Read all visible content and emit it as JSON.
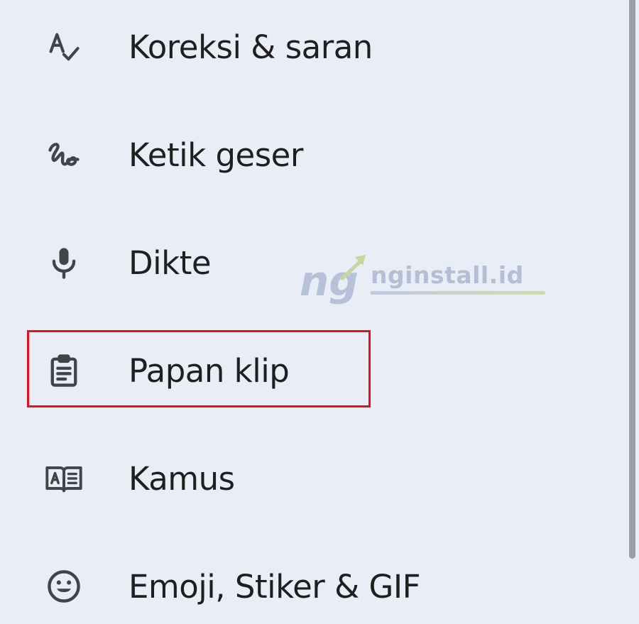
{
  "menu": {
    "items": [
      {
        "label": "Koreksi & saran",
        "icon": "spellcheck-icon"
      },
      {
        "label": "Ketik geser",
        "icon": "gesture-icon"
      },
      {
        "label": "Dikte",
        "icon": "microphone-icon"
      },
      {
        "label": "Papan klip",
        "icon": "clipboard-icon",
        "highlighted": true
      },
      {
        "label": "Kamus",
        "icon": "dictionary-book-icon"
      },
      {
        "label": "Emoji, Stiker & GIF",
        "icon": "emoji-icon"
      }
    ]
  },
  "watermark": {
    "logo_letters": "ng",
    "text": "nginstall.id"
  },
  "colors": {
    "background": "#e9eef6",
    "text": "#1f1f1f",
    "icon": "#414549",
    "highlight_border": "#e5121c",
    "scrollbar": "#9aa0a6"
  }
}
